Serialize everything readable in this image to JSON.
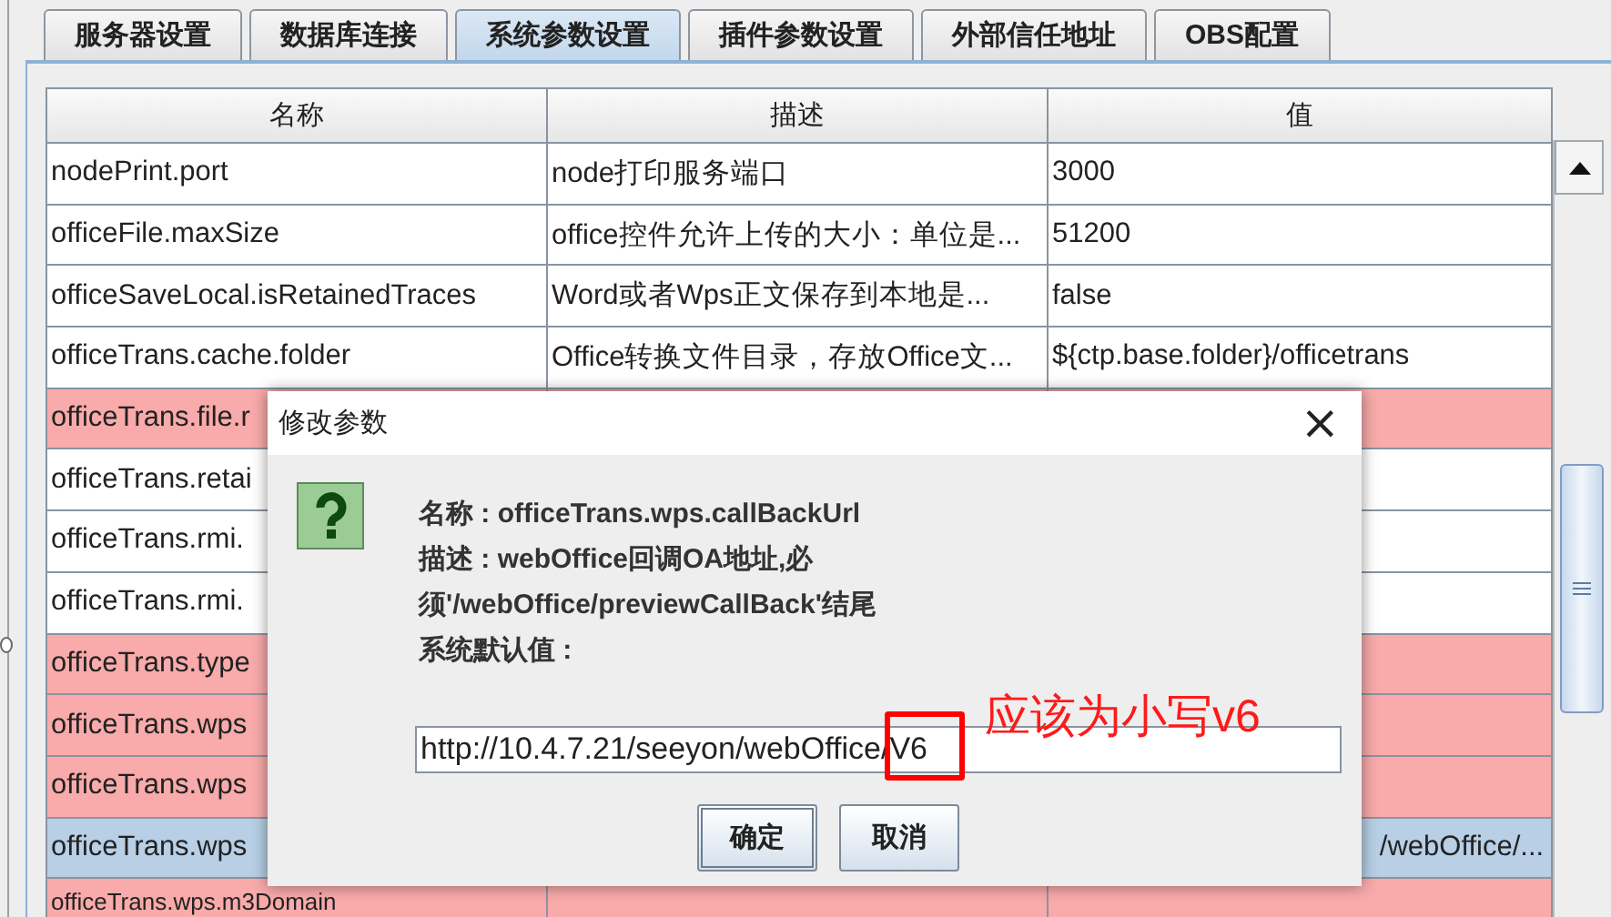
{
  "tabs": [
    {
      "label": "服务器设置",
      "selected": false
    },
    {
      "label": "数据库连接",
      "selected": false
    },
    {
      "label": "系统参数设置",
      "selected": true
    },
    {
      "label": "插件参数设置",
      "selected": false
    },
    {
      "label": "外部信任地址",
      "selected": false
    },
    {
      "label": "OBS配置",
      "selected": false
    }
  ],
  "table": {
    "columns": [
      "名称",
      "描述",
      "值"
    ],
    "rows": [
      {
        "name": "nodePrint.port",
        "description": "node打印服务端口",
        "value": "3000",
        "highlighted": false,
        "selected": false
      },
      {
        "name": "officeFile.maxSize",
        "description": "office控件允许上传的大小：单位是...",
        "value": "51200",
        "highlighted": false,
        "selected": false
      },
      {
        "name": "officeSaveLocal.isRetainedTraces",
        "description": "Word或者Wps正文保存到本地是...",
        "value": "false",
        "highlighted": false,
        "selected": false
      },
      {
        "name": "officeTrans.cache.folder",
        "description": "Office转换文件目录，存放Office文...",
        "value": "${ctp.base.folder}/officetrans",
        "highlighted": false,
        "selected": false
      },
      {
        "name": "officeTrans.file.r",
        "highlighted": true,
        "selected": false
      },
      {
        "name": "officeTrans.retai",
        "highlighted": false,
        "selected": false
      },
      {
        "name": "officeTrans.rmi.",
        "highlighted": false,
        "selected": false
      },
      {
        "name": "officeTrans.rmi.",
        "highlighted": false,
        "selected": false
      },
      {
        "name": "officeTrans.type",
        "highlighted": true,
        "selected": false
      },
      {
        "name": "officeTrans.wps",
        "highlighted": true,
        "selected": false
      },
      {
        "name": "officeTrans.wps",
        "highlighted": true,
        "selected": false
      },
      {
        "name": "officeTrans.wps",
        "value": "/webOffice/...",
        "highlighted": false,
        "selected": true
      },
      {
        "name": "officeTrans.wps.m3Domain",
        "highlighted": true,
        "selected": false
      }
    ]
  },
  "dialog": {
    "title": "修改参数",
    "close": "×",
    "lines": [
      "名称 : officeTrans.wps.callBackUrl",
      "描述 : webOffice回调OA地址,必",
      "须'/webOffice/previewCallBack'结尾",
      "系统默认值 :"
    ],
    "value": "http://10.4.7.21/seeyon/webOffice/V6",
    "buttons": [
      "确定",
      "取消"
    ]
  },
  "annotation": {
    "text": "应该为小写v6"
  }
}
